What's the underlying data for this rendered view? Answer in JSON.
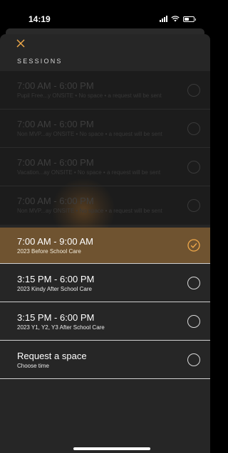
{
  "status_bar": {
    "time": "14:19"
  },
  "header": {
    "close_icon": "close-icon",
    "title": "SESSIONS"
  },
  "colors": {
    "accent": "#f0a94a",
    "selected_row": "#6f5330",
    "sheet": "#262626"
  },
  "sessions": [
    {
      "time": "7:00 AM - 6:00 PM",
      "subtitle": "Pupil Free...y ONSITE • No space • a request will be sent",
      "state": "disabled"
    },
    {
      "time": "7:00 AM - 6:00 PM",
      "subtitle": "Non MVP...ay ONSITE • No space • a request will be sent",
      "state": "disabled"
    },
    {
      "time": "7:00 AM - 6:00 PM",
      "subtitle": "Vacation...ay ONSITE • No space • a request will be sent",
      "state": "disabled"
    },
    {
      "time": "7:00 AM - 6:00 PM",
      "subtitle": "Non MVP...ay ONSITE • No space • a request will be sent",
      "state": "disabled"
    },
    {
      "time": "7:00 AM - 9:00 AM",
      "subtitle": "2023 Before School Care",
      "state": "selected"
    },
    {
      "time": "3:15 PM - 6:00 PM",
      "subtitle": "2023 Kindy After School Care",
      "state": "available"
    },
    {
      "time": "3:15 PM - 6:00 PM",
      "subtitle": "2023 Y1, Y2, Y3 After School Care",
      "state": "available"
    },
    {
      "time": "Request a space",
      "subtitle": "Choose time",
      "state": "available"
    }
  ]
}
